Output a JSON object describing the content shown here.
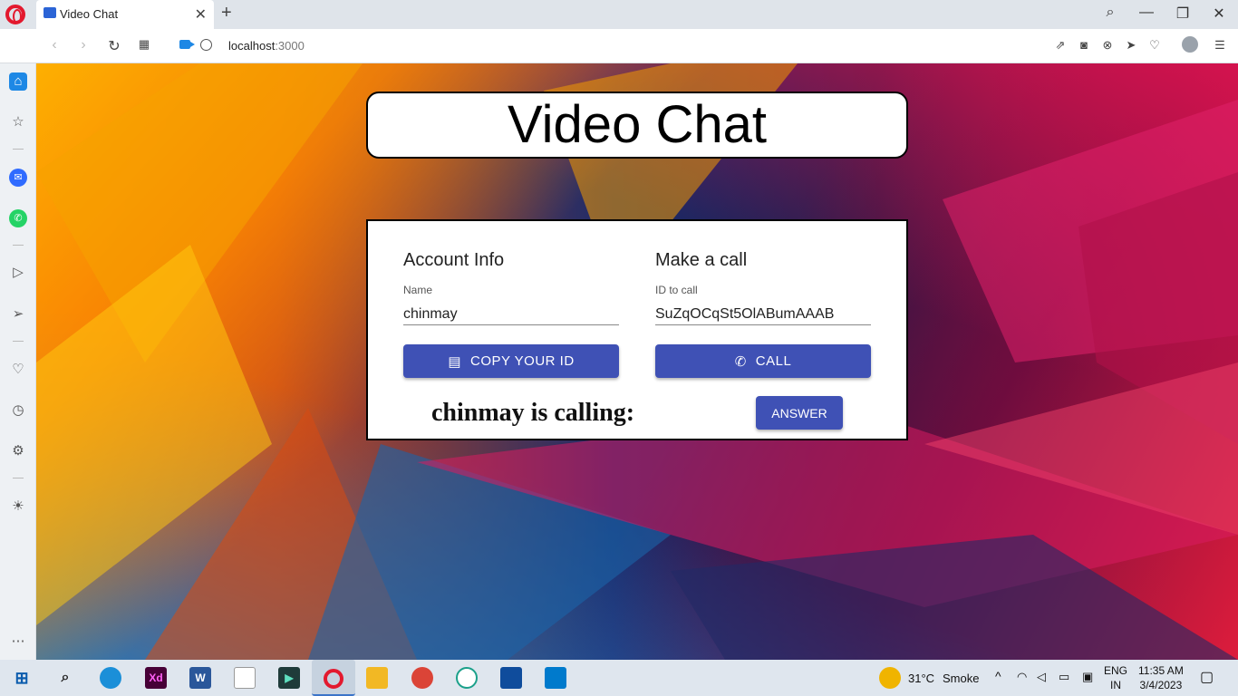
{
  "browser": {
    "tab_title": "Video Chat",
    "tab_close": "✕",
    "new_tab": "+",
    "url_host": "localhost",
    "url_port": ":3000",
    "window_controls": {
      "search": "⌕",
      "minimize": "—",
      "restore": "❐",
      "close": "✕"
    }
  },
  "page": {
    "title": "Video Chat",
    "account": {
      "heading": "Account Info",
      "name_label": "Name",
      "name_value": "chinmay",
      "copy_button": "COPY YOUR ID"
    },
    "call": {
      "heading": "Make a call",
      "id_label": "ID to call",
      "id_value": "SuZqOCqSt5OlABumAAAB",
      "call_button": "CALL"
    },
    "incoming": {
      "message": "chinmay is calling:",
      "answer_button": "ANSWER"
    }
  },
  "taskbar": {
    "weather_temp": "31°C",
    "weather_desc": "Smoke",
    "lang": "ENG",
    "region": "IN",
    "time": "11:35 AM",
    "date": "3/4/2023",
    "xd_label": "Xd",
    "word_label": "W"
  },
  "colors": {
    "primary": "#3f51b5",
    "opera_red": "#e3192e"
  }
}
